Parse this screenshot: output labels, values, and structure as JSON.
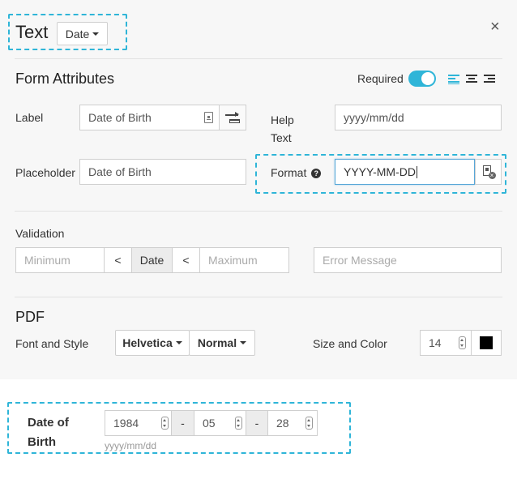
{
  "header": {
    "title": "Text",
    "type_dropdown": "Date",
    "close_glyph": "×"
  },
  "form_attributes": {
    "heading": "Form Attributes",
    "required_label": "Required",
    "required_on": true,
    "label_label": "Label",
    "label_value": "Date of Birth",
    "help_text_label": "Help Text",
    "help_text_value": "yyyy/mm/dd",
    "placeholder_label": "Placeholder",
    "placeholder_value": "Date of Birth",
    "format_label": "Format",
    "format_value": "YYYY-MM-DD"
  },
  "validation": {
    "heading": "Validation",
    "minimum_placeholder": "Minimum",
    "lt1": "<",
    "date_label": "Date",
    "lt2": "<",
    "maximum_placeholder": "Maximum",
    "error_placeholder": "Error Message"
  },
  "pdf": {
    "heading": "PDF",
    "font_style_label": "Font and Style",
    "font": "Helvetica",
    "style": "Normal",
    "size_color_label": "Size and Color",
    "size": "14",
    "color": "#000000"
  },
  "preview": {
    "label": "Date of Birth",
    "year": "1984",
    "month": "05",
    "day": "28",
    "sep1": "-",
    "sep2": "-",
    "help": "yyyy/mm/dd"
  },
  "colors": {
    "accent": "#2fb5d8",
    "align_active": "#2fb5d8"
  }
}
